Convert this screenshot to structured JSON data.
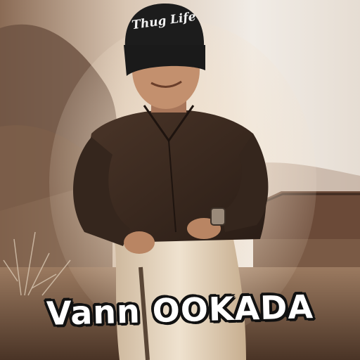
{
  "meme": {
    "caption": "Vann OOKADA",
    "beanie_text": "Thug Life"
  },
  "colors": {
    "sky": "#efe9e2",
    "haze": "#c9ab8d",
    "hill": "#6d5140",
    "shirt": "#3b2a20",
    "mundu": "#e8d9c4",
    "beanie": "#1c1c1c",
    "lens": "#2ea7e8",
    "caption_fill": "#ffffff",
    "caption_outline": "#111111"
  }
}
